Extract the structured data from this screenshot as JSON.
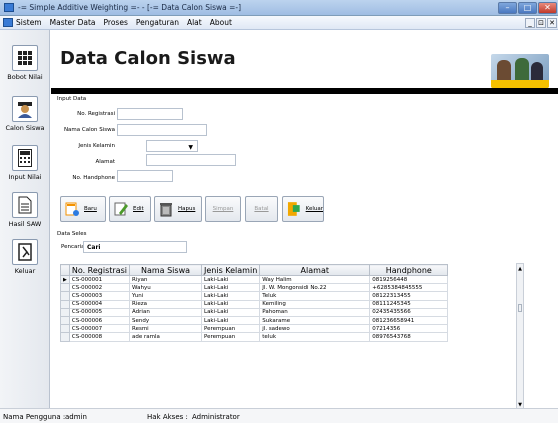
{
  "window": {
    "title": "-= Simple Additive Weighting =- - [-= Data Calon Siswa =-]",
    "min": "–",
    "max": "□",
    "close": "✕"
  },
  "menu": [
    "Sistem",
    "Master Data",
    "Proses",
    "Pengaturan",
    "Alat",
    "About"
  ],
  "menu_ctrls": [
    "_",
    "⊡",
    "✕"
  ],
  "sidebar": [
    {
      "label": "Bobot Nilai",
      "icon": "grid-icon"
    },
    {
      "label": "Calon Siswa",
      "icon": "student-icon"
    },
    {
      "label": "Input Nilai",
      "icon": "calculator-icon"
    },
    {
      "label": "Hasil SAW",
      "icon": "document-icon"
    },
    {
      "label": "Keluar",
      "icon": "exit-icon"
    }
  ],
  "header": {
    "title": "Data Calon Siswa"
  },
  "input_section": {
    "label": "Input Data"
  },
  "form": {
    "fields": [
      {
        "label": "No. Registrasi",
        "value": ""
      },
      {
        "label": "Nama Calon Siswa",
        "value": ""
      },
      {
        "label": "Jenis Kelamin",
        "value": ""
      },
      {
        "label": "Alamat",
        "value": ""
      },
      {
        "label": "No. Handphone",
        "value": ""
      }
    ]
  },
  "toolbar": {
    "baru": "Baru",
    "edit": "Edit",
    "hapus": "Hapus",
    "simpan": "Simpan",
    "batal": "Batal",
    "keluar": "Keluar"
  },
  "data_section": {
    "label": "Data Seles"
  },
  "search": {
    "label": "Pencarian",
    "value": "Cari"
  },
  "table": {
    "columns": [
      "No. Registrasi",
      "Nama Siswa",
      "Jenis Kelamin",
      "Alamat",
      "Handphone"
    ],
    "rows": [
      [
        "CS-000001",
        "Riyan",
        "Laki-Laki",
        "Way Halim",
        "0819256448"
      ],
      [
        "CS-000002",
        "Wahyu",
        "Laki-Laki",
        "Jl. W. Mongonsidi No.22",
        "+6285384845555"
      ],
      [
        "CS-000003",
        "Yuni",
        "Laki-Laki",
        "Teluk",
        "08122313455"
      ],
      [
        "CS-000004",
        "Rieza",
        "Laki-Laki",
        "Kemiling",
        "08111245345"
      ],
      [
        "CS-000005",
        "Adrian",
        "Laki-Laki",
        "Pahoman",
        "02435435566"
      ],
      [
        "CS-000006",
        "Sendy",
        "Laki-Laki",
        "Sukarame",
        "081236658941"
      ],
      [
        "CS-000007",
        "Resmi",
        "Perempuan",
        "jl. sadewo",
        "07214356"
      ],
      [
        "CS-000008",
        "ade ramla",
        "Perempuan",
        "teluk",
        "08976543768"
      ]
    ]
  },
  "status": {
    "user_label": "Nama Pengguna :",
    "user": "admin",
    "access_label": "Hak Akses :",
    "access": "Administrator"
  }
}
